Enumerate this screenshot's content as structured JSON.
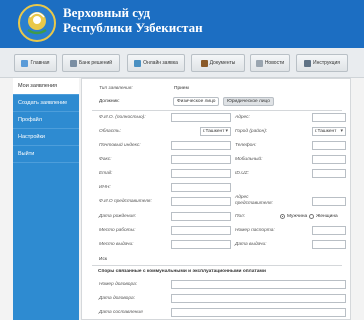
{
  "header": {
    "title_line1": "Верховный суд",
    "title_line2": "Республики Узбекистан"
  },
  "nav": {
    "items": [
      {
        "label": "Главная",
        "icon": "home-icon"
      },
      {
        "label": "Банк решений",
        "icon": "bank-icon"
      },
      {
        "label": "Онлайн заявка",
        "icon": "online-request-icon"
      },
      {
        "label": "Документы",
        "icon": "documents-icon"
      },
      {
        "label": "Новости",
        "icon": "news-icon"
      },
      {
        "label": "Инструкция",
        "icon": "instruction-icon"
      }
    ]
  },
  "sidebar": {
    "items": [
      {
        "label": "Мои заявления",
        "active": true
      },
      {
        "label": "Создать заявление",
        "active": false
      },
      {
        "label": "Профайл",
        "active": false
      },
      {
        "label": "Настройки",
        "active": false
      },
      {
        "label": "Выйти",
        "active": false
      }
    ]
  },
  "form": {
    "request_type_label": "Тип заявления:",
    "request_type_value": "Прием",
    "debtor_label": "Должник:",
    "debtor_tabs": [
      "Физическое лицо",
      "Юридическое лицо"
    ],
    "fio_label": "Ф.И.О. (полностью):",
    "address_label": "Адрес:",
    "region_label": "Область:",
    "region_value": "г.Ташкент",
    "city_label": "Город (район):",
    "city_value": "г.Ташкент",
    "postal_label": "Почтовый индекс:",
    "phone_label": "Телефон:",
    "fax_label": "Факс:",
    "mobile_label": "Мобильный:",
    "email_label": "Email:",
    "id_label": "ID.UZ:",
    "inn_label": "ИНН:",
    "rep_fio_label": "Ф.И.О представителя:",
    "rep_address_label": "Адрес представителя:",
    "birth_label": "Дата рождения:",
    "sex_label": "Пол:",
    "sex_options": [
      "Мужчина",
      "Женщина"
    ],
    "work_label": "Место работы:",
    "passport_label": "Номер паспорта:",
    "issued_place_label": "Место выдачи:",
    "issued_date_label": "Дата выдачи:",
    "claim_label": "Иск",
    "section_title": "Споры связанные с коммунальными и эксплуатационными оплатами",
    "contract_no_label": "Номер договора:",
    "contract_date_label": "Дата договора:",
    "contract_state_label": "Дата составления"
  },
  "colors": {
    "header_bg": "#1c6ec2",
    "sidebar_bg": "#2e8bd1"
  }
}
